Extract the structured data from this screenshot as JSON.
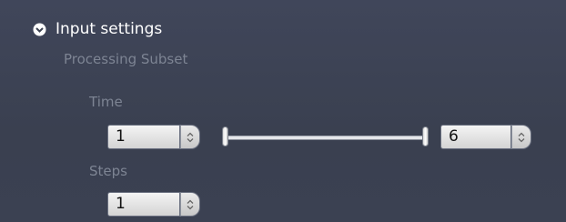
{
  "section": {
    "title": "Input settings",
    "icon": "chevron-down-circle-icon"
  },
  "processing_subset": {
    "label": "Processing Subset",
    "time": {
      "label": "Time",
      "start_value": "1",
      "end_value": "6",
      "range_fraction_start": 0,
      "range_fraction_end": 1
    },
    "steps": {
      "label": "Steps",
      "value": "1"
    }
  },
  "colors": {
    "background": "#3c4251",
    "label_dim": "#7d8493",
    "title": "#ffffff"
  }
}
